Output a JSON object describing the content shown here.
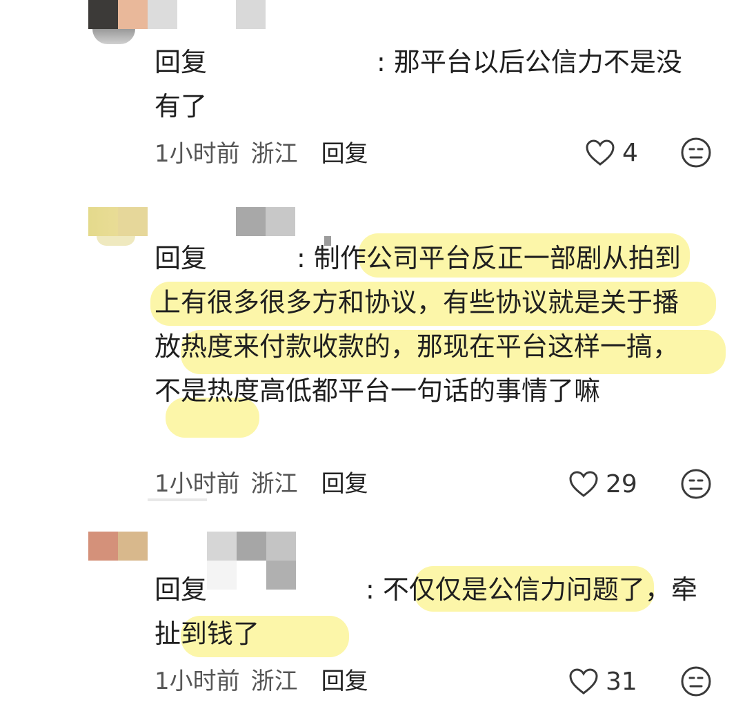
{
  "comments": [
    {
      "reply_label": "回复",
      "separator": ": ",
      "body": "那平台以后公信力不是没有了",
      "time": "1小时前",
      "location": "浙江",
      "reply_button": "回复",
      "likes": "4"
    },
    {
      "reply_label": "回复",
      "separator": ": ",
      "body": "制作公司平台反正一部剧从拍到上有很多很多方和协议，有些协议就是关于播放热度来付款收款的，那现在平台这样一搞，不是热度高低都平台一句话的事情了嘛",
      "time": "1小时前",
      "location": "浙江",
      "reply_button": "回复",
      "likes": "29"
    },
    {
      "reply_label": "回复",
      "separator": ": ",
      "body": "不仅仅是公信力问题了，牵扯到钱了",
      "time": "1小时前",
      "location": "浙江",
      "reply_button": "回复",
      "likes": "31"
    }
  ],
  "colors": {
    "highlight": "#fbf59a",
    "text": "#1f1f1f",
    "meta": "#555555"
  },
  "icons": {
    "like": "heart-outline-icon",
    "dislike": "neutral-face-icon"
  }
}
